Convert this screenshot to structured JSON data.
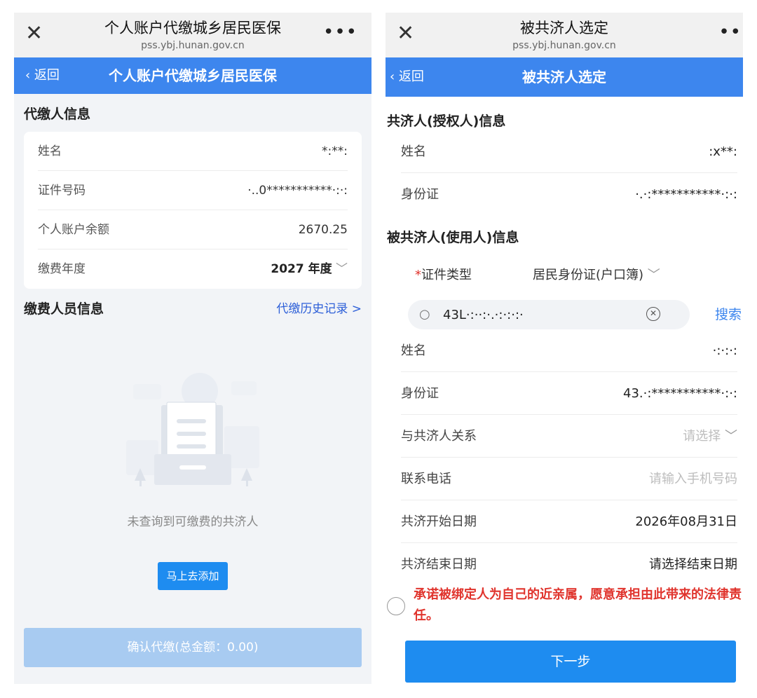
{
  "left": {
    "browser": {
      "title": "个人账户代缴城乡居民医保",
      "domain": "pss.ybj.hunan.gov.cn"
    },
    "nav": {
      "back_label": "返回",
      "title": "个人账户代缴城乡居民医保"
    },
    "payer_section_title": "代缴人信息",
    "payer": {
      "name_label": "姓名",
      "name_value": "*:**:",
      "id_label": "证件号码",
      "id_value": "·..0***********·:·:",
      "balance_label": "个人账户余额",
      "balance_value": "2670.25",
      "year_label": "缴费年度",
      "year_value": "2027 年度"
    },
    "members_section_title": "缴费人员信息",
    "history_link": "代缴历史记录 >",
    "empty_text": "未查询到可缴费的共济人",
    "add_button": "马上去添加",
    "confirm_button": "确认代缴(总金额：0.00)"
  },
  "right": {
    "browser": {
      "title": "被共济人选定",
      "domain": "pss.ybj.hunan.gov.cn"
    },
    "nav": {
      "back_label": "返回",
      "title": "被共济人选定"
    },
    "grantor_section_title": "共济人(授权人)信息",
    "grantor": {
      "name_label": "姓名",
      "name_value": ":x**:",
      "id_label": "身份证",
      "id_value": "·.·:***********·:·:"
    },
    "user_section_title": "被共济人(使用人)信息",
    "cert_required_mark": "*",
    "cert_type_label": "证件类型",
    "cert_type_value": "居民身份证(户口簿)",
    "search_value": "43L·:··:·.·:·:·:·",
    "search_button": "搜索",
    "user": {
      "name_label": "姓名",
      "name_value": "·:·:·:",
      "id_label": "身份证",
      "id_value": "43.·:***********·:·:",
      "relation_label": "与共济人关系",
      "relation_placeholder": "请选择",
      "phone_label": "联系电话",
      "phone_placeholder": "请输入手机号码",
      "start_label": "共济开始日期",
      "start_value": "2026年08月31日",
      "end_label": "共济结束日期",
      "end_value": "请选择结束日期"
    },
    "agreement_text": "承诺被绑定人为自己的近亲属，愿意承担由此带来的法律责任。",
    "next_button": "下一步"
  },
  "colors": {
    "primary": "#3d86ee",
    "button_blue": "#1e8cf0",
    "disabled_blue": "#a8cbf1",
    "warning_red": "#e0342d",
    "link_blue": "#2d5fd8"
  }
}
